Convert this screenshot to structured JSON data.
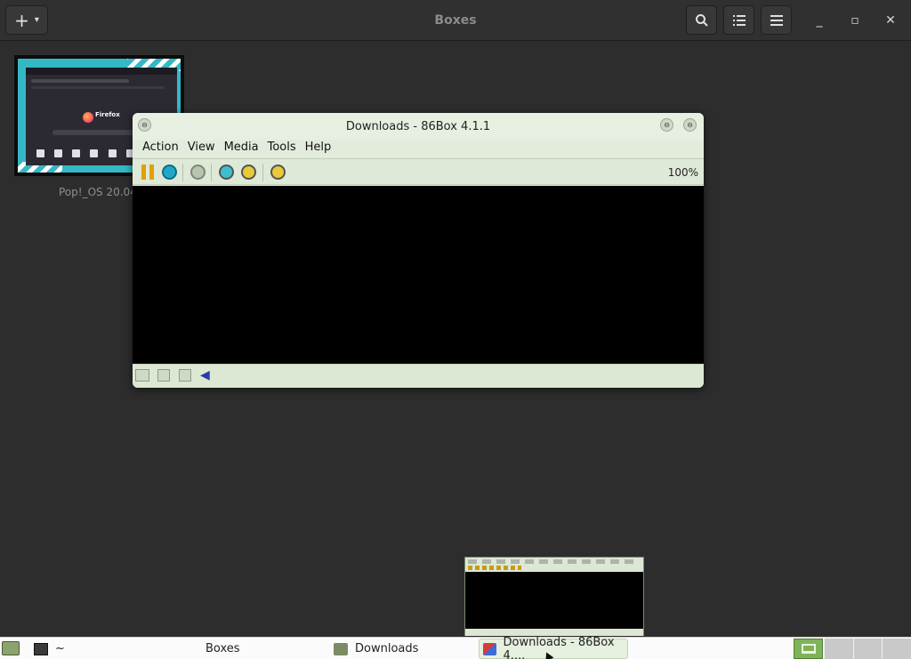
{
  "headerbar": {
    "title": "Boxes",
    "new_label": "+",
    "new_caret": "▾",
    "icons": [
      "search-icon",
      "list-view-icon",
      "hamburger-menu-icon"
    ],
    "window_controls": {
      "minimize": "_",
      "maximize": "▫",
      "close": "✕"
    }
  },
  "vm_tile": {
    "label": "Pop!_OS 20.04",
    "thumbnail_browser_brand": "Firefox"
  },
  "box86_window": {
    "title": "Downloads - 86Box 4.1.1",
    "menus": [
      "Action",
      "View",
      "Media",
      "Tools",
      "Help"
    ],
    "toolbar_icons": [
      "pause-icon",
      "hard-reset-icon",
      "power-icon",
      "ctrl-alt-del-icon",
      "ctrl-alt-esc-icon",
      "settings-icon"
    ],
    "zoom": "100%",
    "status_icons": [
      "keyboard-icon",
      "floppy-1-icon",
      "floppy-2-icon",
      "sound-icon"
    ],
    "titlebar_glyph": "⊖"
  },
  "taskbar": {
    "items": [
      {
        "label": "~",
        "icon": "terminal-icon",
        "active": false
      },
      {
        "label": "Boxes",
        "icon": "boxes-icon",
        "active": false
      },
      {
        "label": "Downloads",
        "icon": "folder-icon",
        "active": false
      },
      {
        "label": "Downloads - 86Box 4....",
        "icon": "86box-icon",
        "active": true
      }
    ],
    "workspaces": 4,
    "active_workspace": 1
  },
  "colors": {
    "background": "#2d2d2d",
    "window_bg": "#dde8d4",
    "accent_green": "#7fb35a",
    "vm_thumbnail": "#35b8c6"
  }
}
